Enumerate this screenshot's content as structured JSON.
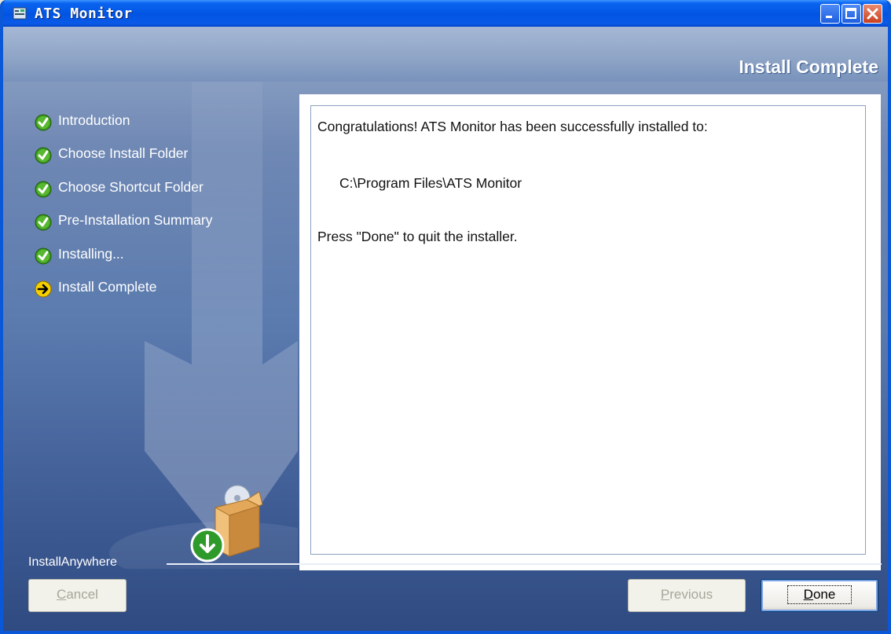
{
  "window": {
    "title": "ATS Monitor",
    "controls": [
      "minimize-icon",
      "maximize-icon",
      "close-icon"
    ]
  },
  "panel_title": "Install Complete",
  "steps": [
    {
      "label": "Introduction",
      "status": "done",
      "icon": "check-circle-icon"
    },
    {
      "label": "Choose Install Folder",
      "status": "done",
      "icon": "check-circle-icon"
    },
    {
      "label": "Choose Shortcut Folder",
      "status": "done",
      "icon": "check-circle-icon"
    },
    {
      "label": "Pre-Installation Summary",
      "status": "done",
      "icon": "check-circle-icon"
    },
    {
      "label": "Installing...",
      "status": "done",
      "icon": "check-circle-icon"
    },
    {
      "label": "Install Complete",
      "status": "current",
      "icon": "arrow-right-circle-icon"
    }
  ],
  "content": {
    "congrats": "Congratulations! ATS Monitor has been successfully installed to:",
    "install_path": "C:\\Program Files\\ATS Monitor",
    "instruction": "Press \"Done\" to quit the installer."
  },
  "footer": {
    "brand": "InstallAnywhere",
    "cancel": {
      "label": "Cancel",
      "mnemonic": "C",
      "rest": "ancel",
      "enabled": false
    },
    "previous": {
      "label": "Previous",
      "mnemonic": "P",
      "rest": "revious",
      "enabled": false
    },
    "done": {
      "label": "Done",
      "mnemonic": "D",
      "rest": "one",
      "enabled": true
    }
  },
  "colors": {
    "titlebar": "#0254e2",
    "check": "#3c9a1e",
    "current_arrow": "#f5d000"
  }
}
